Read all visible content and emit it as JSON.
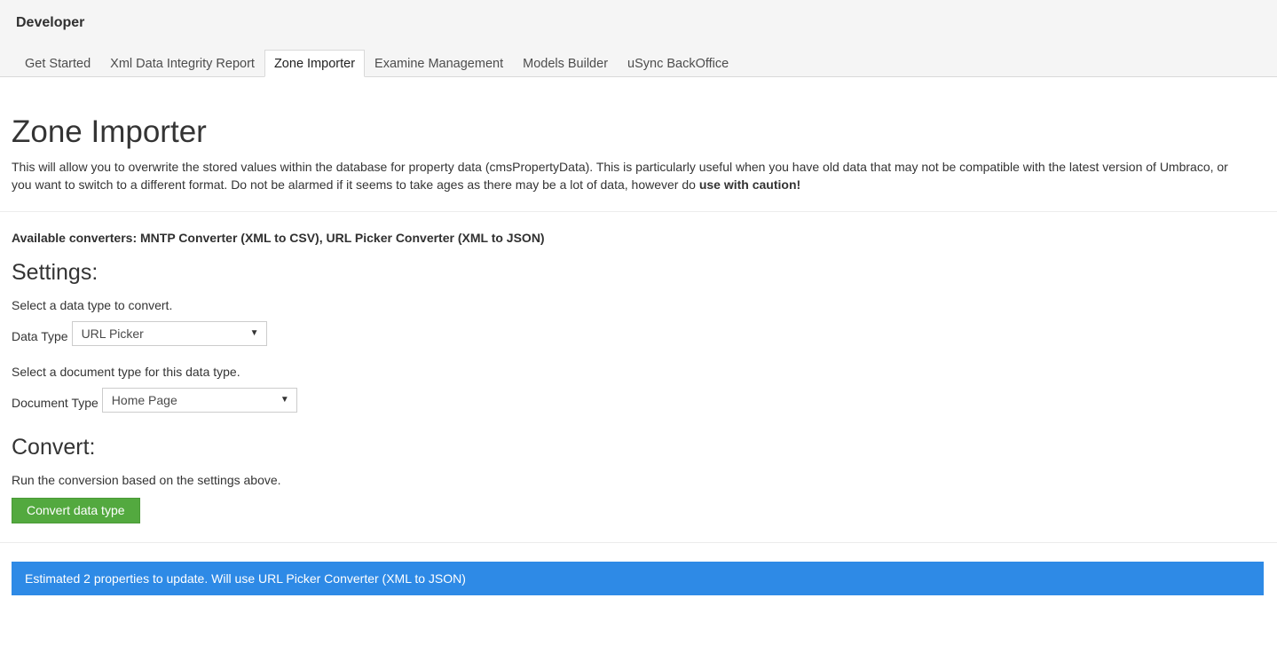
{
  "header": {
    "section_title": "Developer",
    "tabs": [
      {
        "label": "Get Started"
      },
      {
        "label": "Xml Data Integrity Report"
      },
      {
        "label": "Zone Importer",
        "active": true
      },
      {
        "label": "Examine Management"
      },
      {
        "label": "Models Builder"
      },
      {
        "label": "uSync BackOffice"
      }
    ]
  },
  "page": {
    "title": "Zone Importer",
    "intro": "This will allow you to overwrite the stored values within the database for property data (cmsPropertyData). This is particularly useful when you have old data that may not be compatible with the latest version of Umbraco, or you want to switch to a different format. Do not be alarmed if it seems to take ages as there may be a lot of data, however do ",
    "intro_emphasis": "use with caution!",
    "available_converters": "Available converters: MNTP Converter (XML to CSV), URL Picker Converter (XML to JSON)"
  },
  "settings": {
    "heading": "Settings:",
    "data_type_help": "Select a data type to convert.",
    "data_type_label": "Data Type",
    "data_type_value": "URL Picker",
    "document_type_help": "Select a document type for this data type.",
    "document_type_label": "Document Type",
    "document_type_value": "Home Page"
  },
  "convert": {
    "heading": "Convert:",
    "help": "Run the conversion based on the settings above.",
    "button_label": "Convert data type"
  },
  "alert": {
    "message": "Estimated 2 properties to update. Will use URL Picker Converter (XML to JSON)"
  },
  "icons": {
    "dropdown": "chevron-down-icon"
  },
  "colors": {
    "success": "#53a93f",
    "info": "#2e8ae6"
  }
}
